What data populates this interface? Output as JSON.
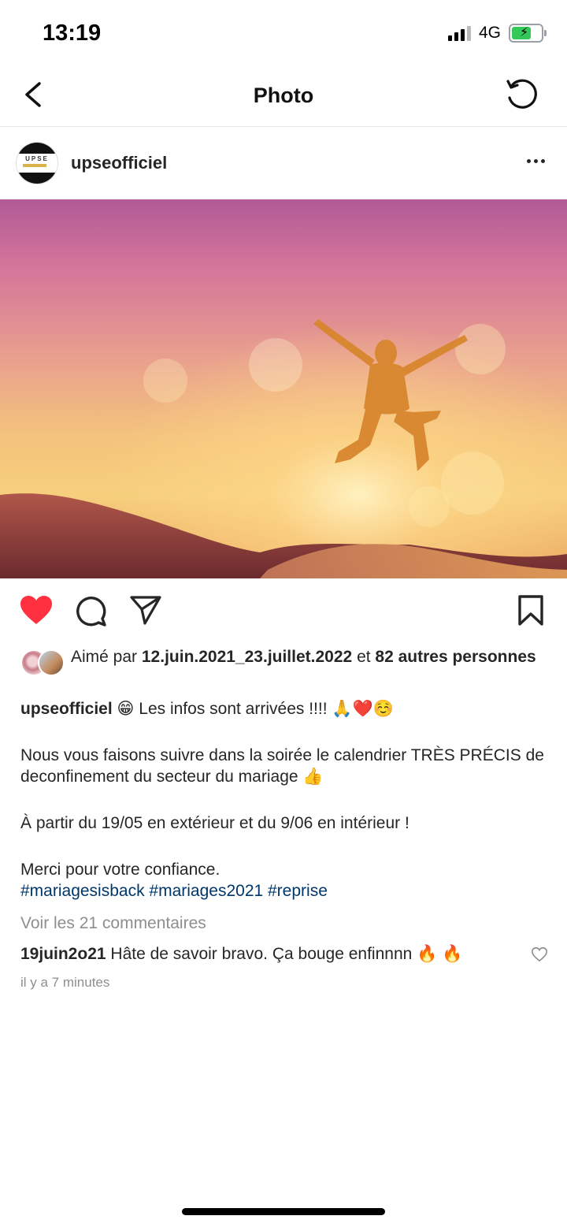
{
  "status_bar": {
    "time": "13:19",
    "network": "4G"
  },
  "nav": {
    "title": "Photo",
    "back_icon": "chevron-left-icon",
    "refresh_icon": "refresh-icon"
  },
  "post": {
    "username": "upseofficiel",
    "avatar_text": "UPSE",
    "more_icon": "more-horizontal-icon",
    "image_alt": "person-jumping-at-sunset",
    "liked": true,
    "colors": {
      "like": "#ff3040",
      "hashtag": "#00376b",
      "muted": "#8e8e8e"
    }
  },
  "likes": {
    "prefix": "Aimé par",
    "user": "12.juin.2021_23.juillet.2022",
    "connector": "et",
    "others": "82 autres personnes"
  },
  "caption": {
    "username": "upseofficiel",
    "line1": " 😁 Les infos sont arrivées !!!! 🙏❤️☺️",
    "line2": "Nous vous faisons suivre dans la soirée le calendrier TRÈS PRÉCIS de deconfinement du secteur du mariage 👍",
    "line3": "À partir du 19/05 en extérieur et du 9/06 en intérieur !",
    "line4": "Merci pour votre confiance.",
    "hashtags": "#mariagesisback #mariages2021 #reprise"
  },
  "comments": {
    "view_all": "Voir les 21 commentaires",
    "items": [
      {
        "username": "19juin2o21",
        "text": " Hâte de savoir bravo. Ça bouge enfinnnn 🔥 🔥"
      }
    ],
    "timestamp": "il y a 7 minutes"
  }
}
